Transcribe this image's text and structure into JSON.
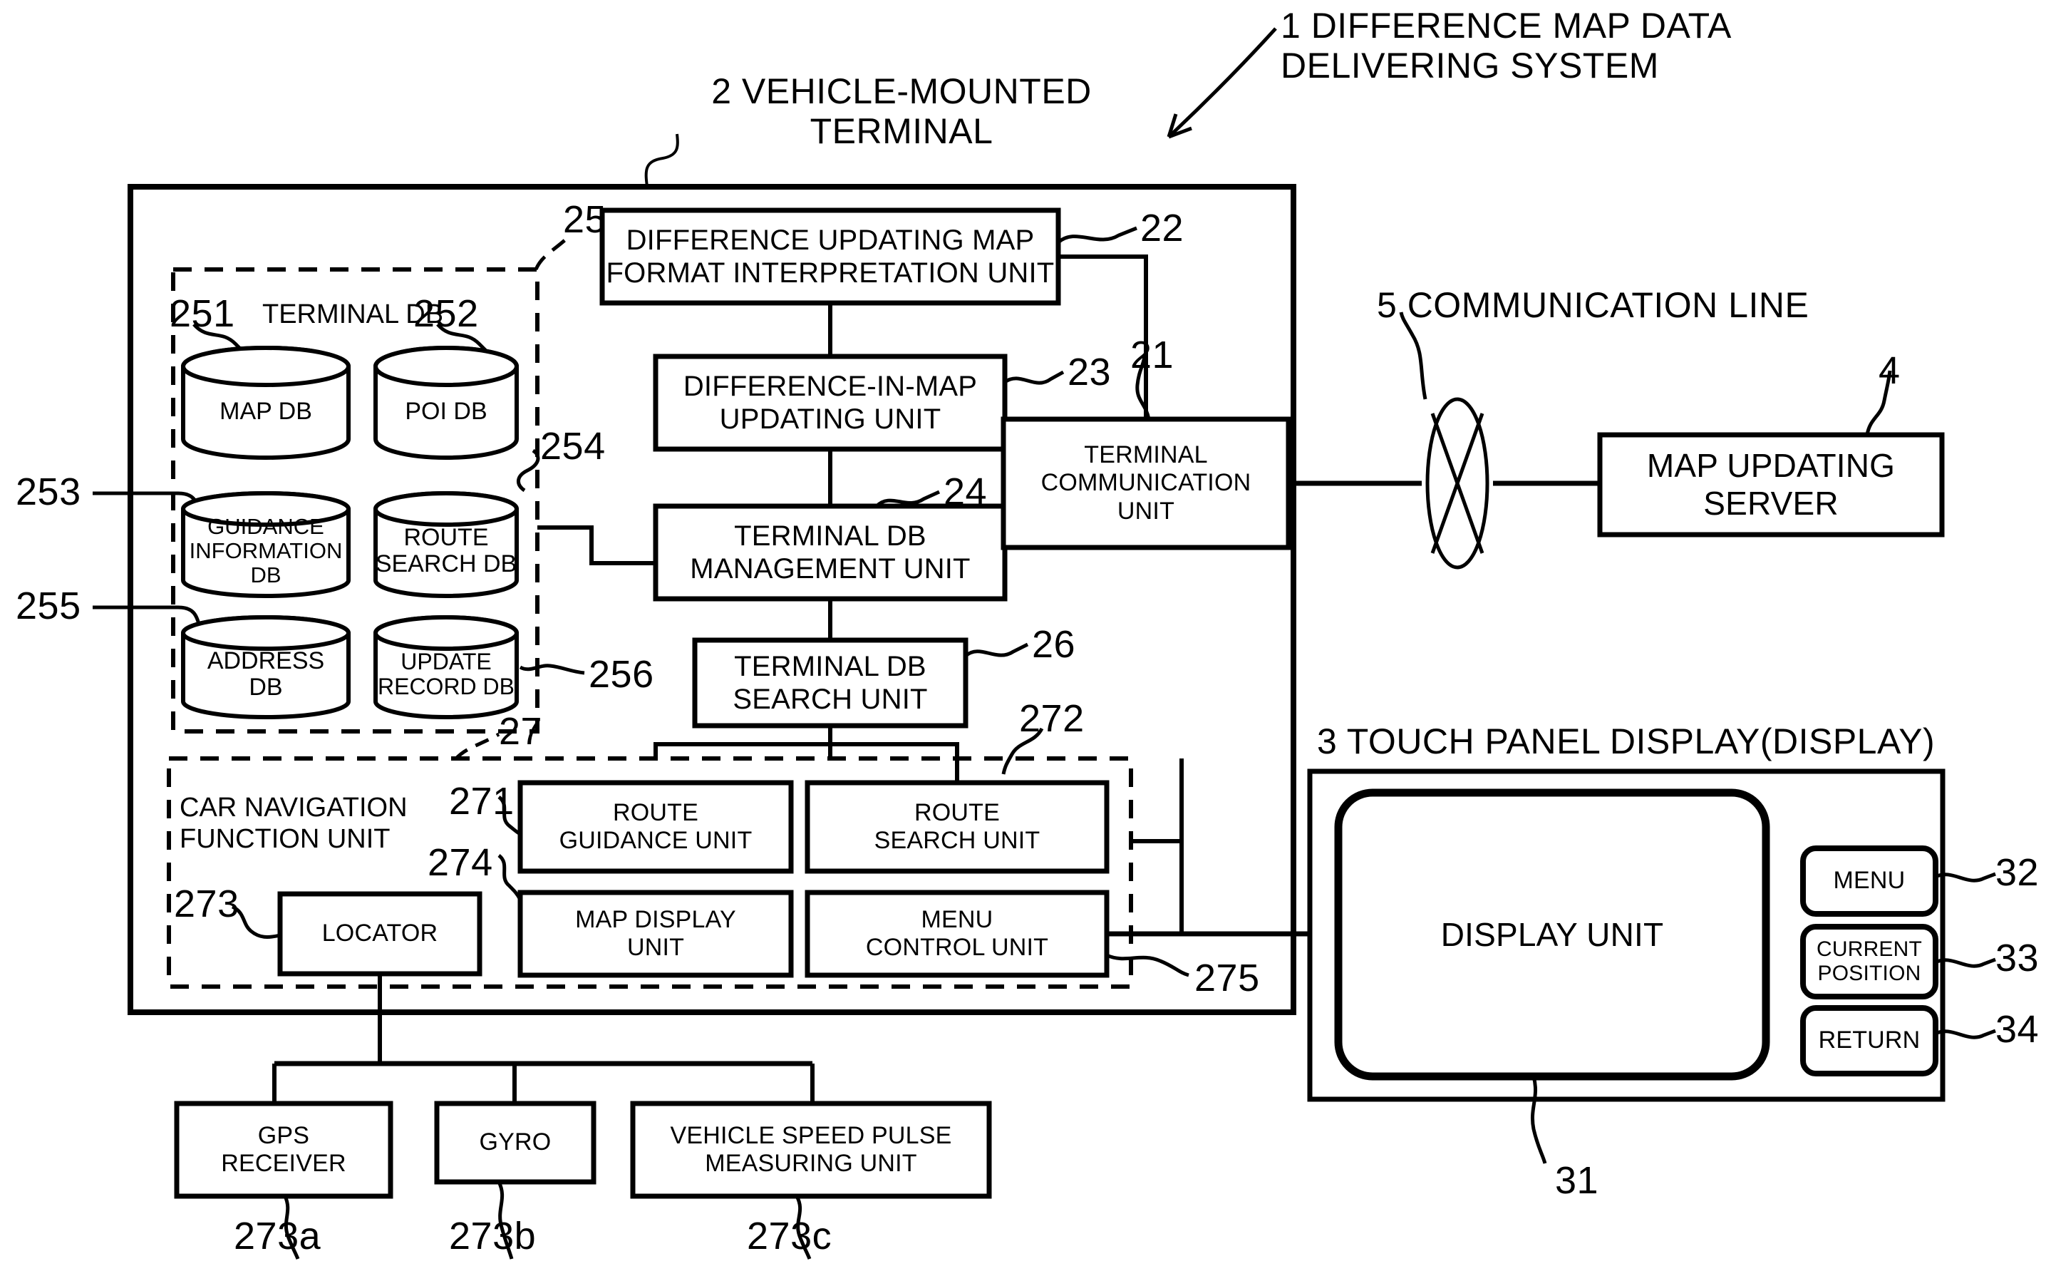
{
  "figure": {
    "system_label": "1 DIFFERENCE MAP DATA\nDELIVERING SYSTEM",
    "terminal_label": "2 VEHICLE-MOUNTED\nTERMINAL",
    "comm_line_label": "5 COMMUNICATION LINE",
    "touch_panel_label": "3 TOUCH PANEL DISPLAY(DISPLAY)"
  },
  "terminal": {
    "db_group": {
      "title": "TERMINAL DB",
      "ref": "25",
      "databases": [
        {
          "ref": "251",
          "label": "MAP DB"
        },
        {
          "ref": "252",
          "label": "POI DB"
        },
        {
          "ref": "253",
          "label": "GUIDANCE\nINFORMATION\nDB"
        },
        {
          "ref": "254",
          "label": "ROUTE\nSEARCH DB"
        },
        {
          "ref": "255",
          "label": "ADDRESS\nDB"
        },
        {
          "ref": "256",
          "label": "UPDATE\nRECORD DB"
        }
      ]
    },
    "units": [
      {
        "ref": "22",
        "label": "DIFFERENCE UPDATING MAP\nFORMAT INTERPRETATION UNIT"
      },
      {
        "ref": "23",
        "label": "DIFFERENCE-IN-MAP\nUPDATING UNIT"
      },
      {
        "ref": "24",
        "label": "TERMINAL DB\nMANAGEMENT UNIT"
      },
      {
        "ref": "26",
        "label": "TERMINAL DB\nSEARCH UNIT"
      },
      {
        "ref": "21",
        "label": "TERMINAL\nCOMMUNICATION\nUNIT"
      }
    ],
    "car_nav": {
      "ref": "27",
      "title": "CAR NAVIGATION\nFUNCTION UNIT",
      "units": [
        {
          "ref": "271",
          "label": "ROUTE\nGUIDANCE UNIT"
        },
        {
          "ref": "272",
          "label": "ROUTE\nSEARCH UNIT"
        },
        {
          "ref": "273",
          "label": "LOCATOR"
        },
        {
          "ref": "274",
          "label": "MAP DISPLAY\nUNIT"
        },
        {
          "ref": "275",
          "label": "MENU\nCONTROL UNIT"
        }
      ]
    },
    "sensors": [
      {
        "ref": "273a",
        "label": "GPS\nRECEIVER"
      },
      {
        "ref": "273b",
        "label": "GYRO"
      },
      {
        "ref": "273c",
        "label": "VEHICLE SPEED PULSE\nMEASURING UNIT"
      }
    ]
  },
  "server": {
    "ref": "4",
    "label": "MAP UPDATING\nSERVER"
  },
  "touch_panel": {
    "display_unit": {
      "ref": "31",
      "label": "DISPLAY UNIT"
    },
    "buttons": [
      {
        "ref": "32",
        "label": "MENU"
      },
      {
        "ref": "33",
        "label": "CURRENT\nPOSITION"
      },
      {
        "ref": "34",
        "label": "RETURN"
      }
    ]
  },
  "colors": {
    "line": "#000000",
    "background": "#ffffff"
  }
}
